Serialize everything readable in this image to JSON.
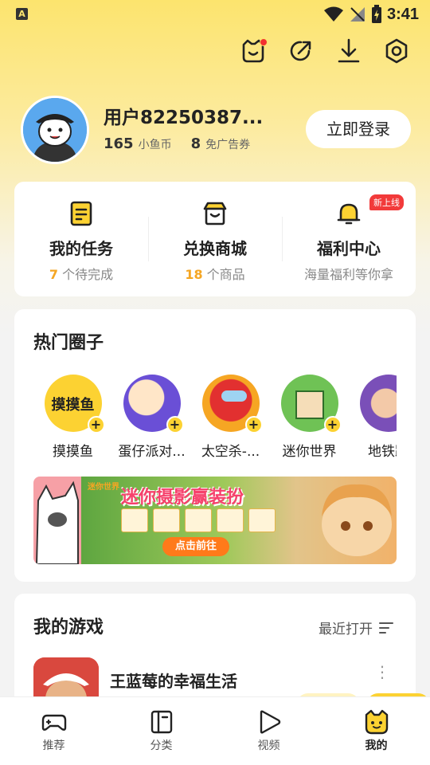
{
  "status_bar": {
    "time": "3:41",
    "app_icon": "A"
  },
  "top_icons": [
    "pet-icon",
    "share-icon",
    "download-icon",
    "settings-icon"
  ],
  "profile": {
    "username": "用户82250387...",
    "coins": "165",
    "coins_unit": "小鱼币",
    "coupons": "8",
    "coupons_unit": "免广告券",
    "login_label": "立即登录"
  },
  "quick_actions": [
    {
      "title": "我的任务",
      "count": "7",
      "sub": " 个待完成",
      "icon": "task-icon"
    },
    {
      "title": "兑换商城",
      "count": "18",
      "sub": " 个商品",
      "icon": "shop-icon"
    },
    {
      "title": "福利中心",
      "count": "",
      "sub": "海量福利等你拿",
      "icon": "bell-icon",
      "badge": "新上线"
    }
  ],
  "circles": {
    "title": "热门圈子",
    "items": [
      {
        "name": "摸摸鱼",
        "logo_text": "摸摸鱼"
      },
      {
        "name": "蛋仔派对..."
      },
      {
        "name": "太空杀-..."
      },
      {
        "name": "迷你世界"
      },
      {
        "name": "地铁跑"
      }
    ],
    "banner": {
      "title": "迷你摄影赢装扮",
      "logo": "迷你世界",
      "button": "点击前往"
    }
  },
  "games": {
    "title": "我的游戏",
    "sort_label": "最近打开",
    "items": [
      {
        "name": "王蓝莓的幸福生活"
      }
    ]
  },
  "tabs": [
    {
      "label": "推荐",
      "icon": "gamepad-icon",
      "active": false
    },
    {
      "label": "分类",
      "icon": "category-icon",
      "active": false
    },
    {
      "label": "视频",
      "icon": "video-icon",
      "active": false
    },
    {
      "label": "我的",
      "icon": "cat-face-icon",
      "active": true
    }
  ],
  "colors": {
    "accent": "#FCD232",
    "highlight": "#F5A623",
    "badge": "#F23A3A"
  }
}
